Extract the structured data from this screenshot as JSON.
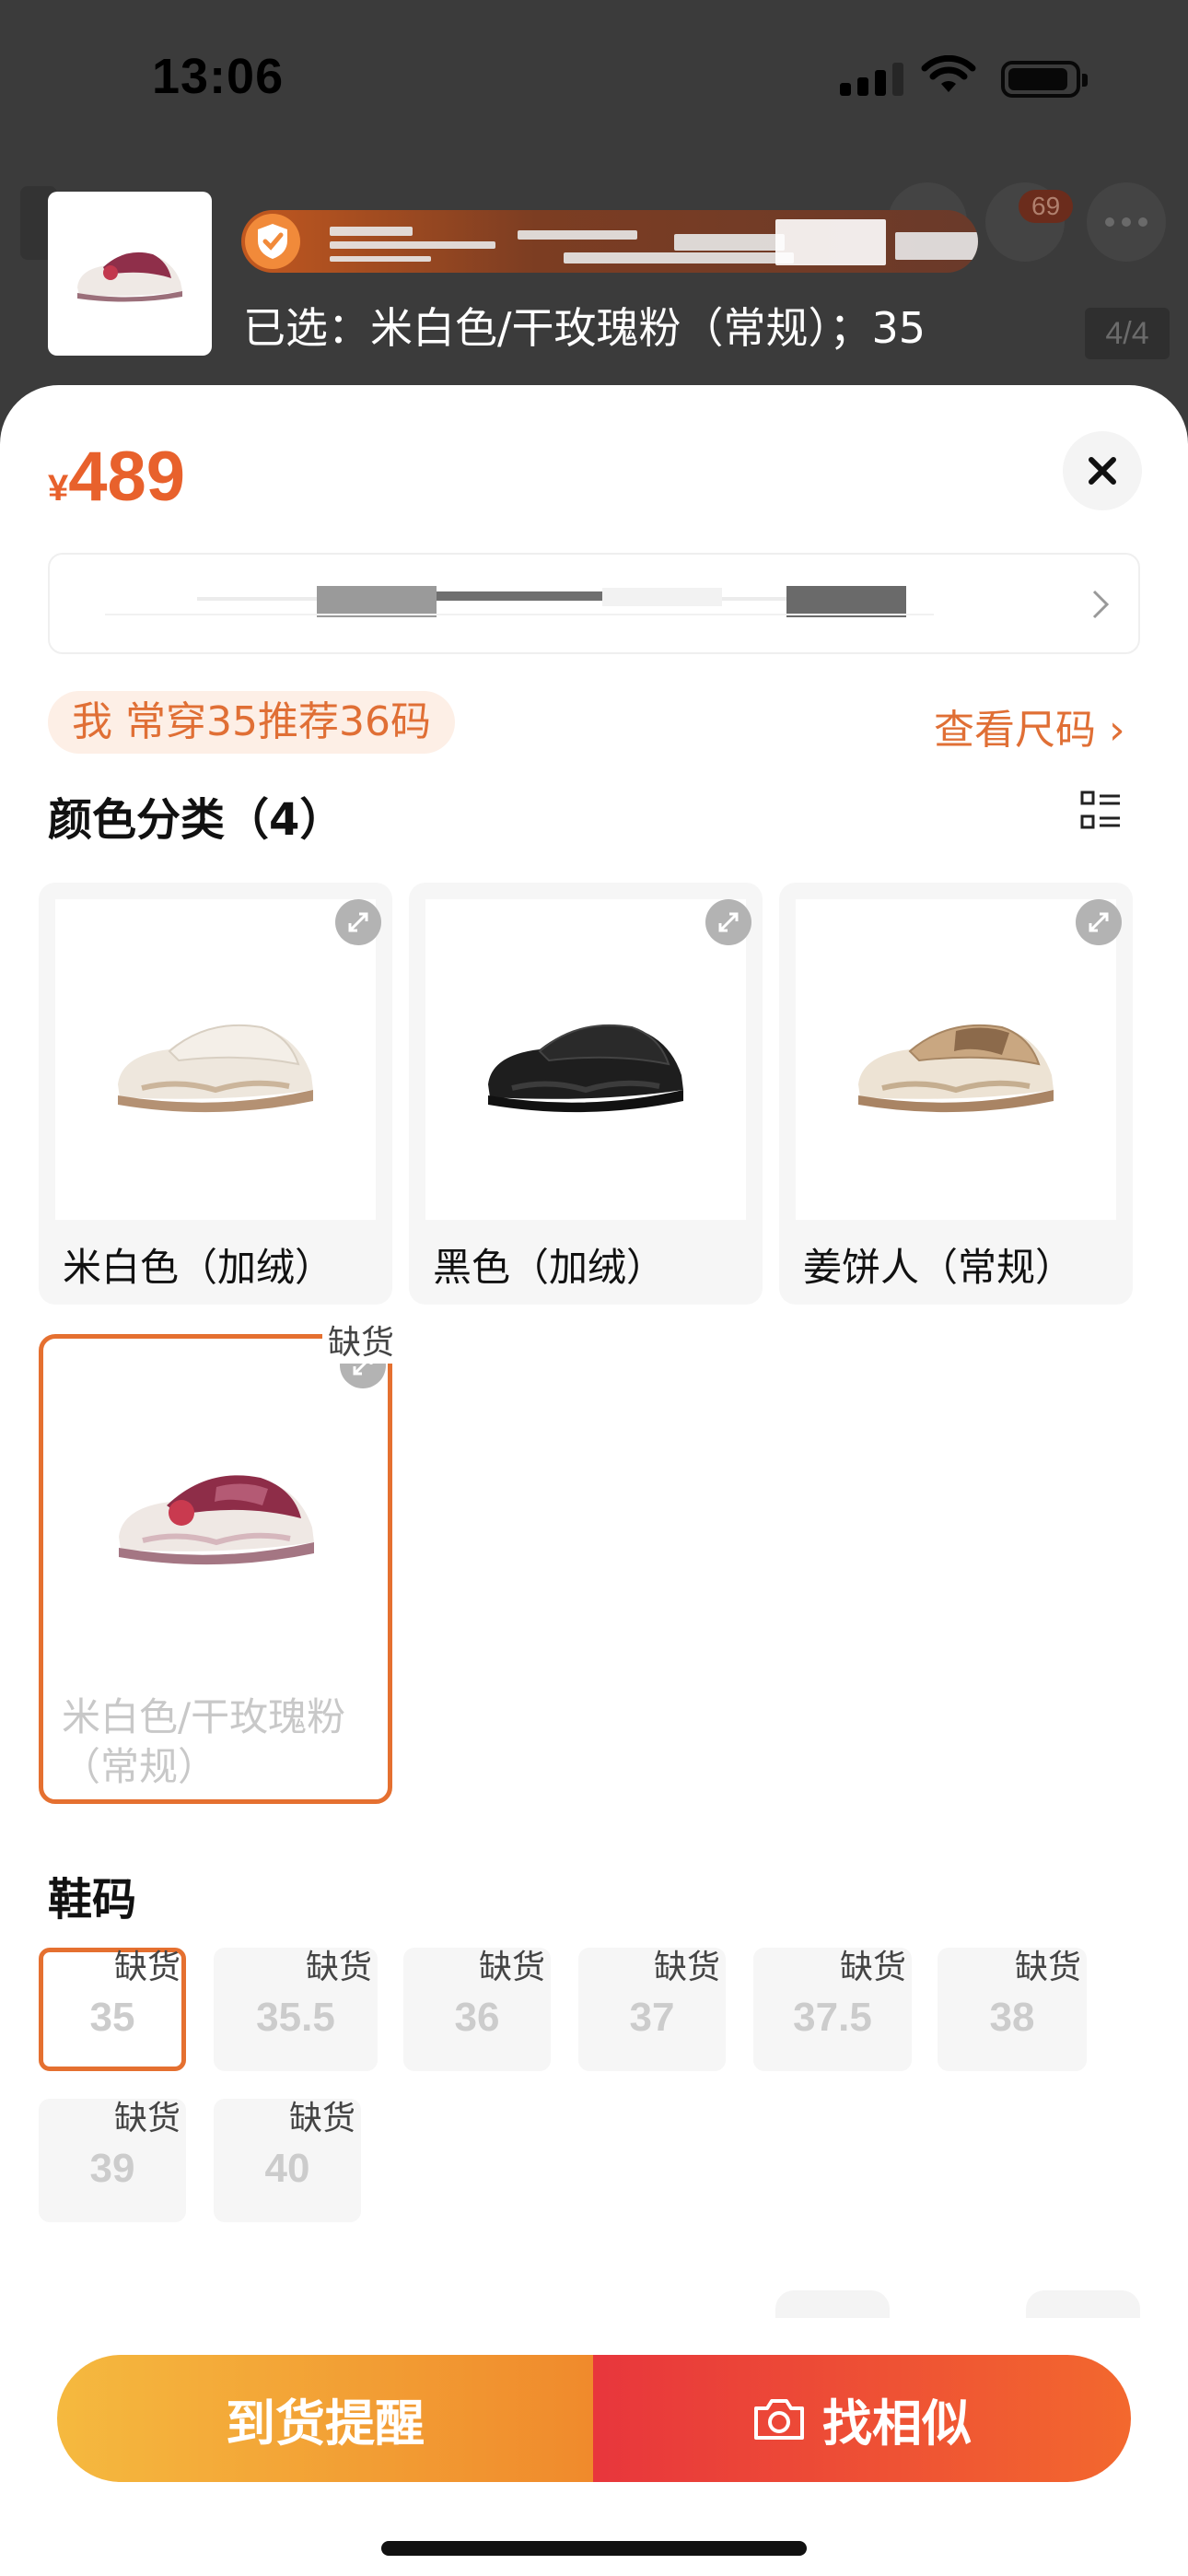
{
  "status_bar": {
    "time": "13:06"
  },
  "header": {
    "cart_badge": "69",
    "page_counter": "4/4",
    "selected_text": "已选：米白色/干玫瑰粉（常规）；35"
  },
  "sheet": {
    "price": {
      "currency": "¥",
      "amount": "489"
    },
    "size_recommendation": "我 常穿35推荐36码",
    "size_chart_link": "查看尺码 ›",
    "color_section": {
      "title": "颜色分类（4）",
      "options": [
        {
          "label": "米白色（加绒）",
          "shoe": "cream"
        },
        {
          "label": "黑色（加绒）",
          "shoe": "black"
        },
        {
          "label": "姜饼人（常规）",
          "shoe": "beige"
        },
        {
          "label": "米白色/干玫瑰粉（常规）",
          "shoe": "rose",
          "selected": true,
          "out_of_stock": "缺货"
        }
      ]
    },
    "size_section": {
      "title": "鞋码",
      "sizes": [
        {
          "value": "35",
          "tag": "缺货",
          "selected": true
        },
        {
          "value": "35.5",
          "tag": "缺货"
        },
        {
          "value": "36",
          "tag": "缺货"
        },
        {
          "value": "37",
          "tag": "缺货"
        },
        {
          "value": "37.5",
          "tag": "缺货"
        },
        {
          "value": "38",
          "tag": "缺货"
        },
        {
          "value": "39",
          "tag": "缺货"
        },
        {
          "value": "40",
          "tag": "缺货"
        }
      ]
    },
    "actions": {
      "notify_label": "到货提醒",
      "similar_label": "找相似"
    }
  },
  "colors": {
    "accent": "#e8612c",
    "selected_border": "#e57030",
    "notify_gradient": [
      "#f5b93f",
      "#f08a2c"
    ],
    "similar_gradient": [
      "#e8363c",
      "#f3682e"
    ]
  }
}
